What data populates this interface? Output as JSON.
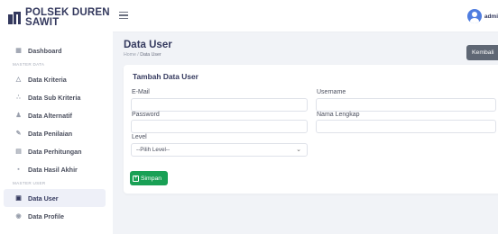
{
  "brand": {
    "line1": "POLSEK DUREN",
    "line2": "SAWIT"
  },
  "sidebar": {
    "items": [
      {
        "label": "Dashboard",
        "icon": "grid-icon"
      },
      {
        "section": "MASTER DATA"
      },
      {
        "label": "Data Kriteria",
        "icon": "kriteria-icon"
      },
      {
        "label": "Data Sub Kriteria",
        "icon": "sub-kriteria-icon"
      },
      {
        "label": "Data Alternatif",
        "icon": "users-icon"
      },
      {
        "label": "Data Penilaian",
        "icon": "edit-icon"
      },
      {
        "label": "Data Perhitungan",
        "icon": "calculator-icon"
      },
      {
        "label": "Data Hasil Akhir",
        "icon": "chart-icon"
      },
      {
        "section": "MASTER USER"
      },
      {
        "label": "Data User",
        "icon": "user-card-icon",
        "active": true
      },
      {
        "label": "Data Profile",
        "icon": "profile-icon"
      }
    ]
  },
  "topbar": {
    "user_name": "admi"
  },
  "page": {
    "title": "Data User",
    "breadcrumb_home": "Home",
    "breadcrumb_sep": "/",
    "breadcrumb_current": "Data User",
    "back_label": "Kembali"
  },
  "form": {
    "title": "Tambah Data User",
    "email_label": "E-Mail",
    "email_value": "",
    "username_label": "Username",
    "username_value": "",
    "password_label": "Password",
    "password_value": "",
    "nama_label": "Nama Lengkap",
    "nama_value": "",
    "level_label": "Level",
    "level_selected": "--Pilih Level--",
    "save_label": "Simpan"
  },
  "colors": {
    "primary": "#34395e",
    "success": "#19a055",
    "secondary": "#5f6774",
    "avatar": "#4f7de0"
  }
}
